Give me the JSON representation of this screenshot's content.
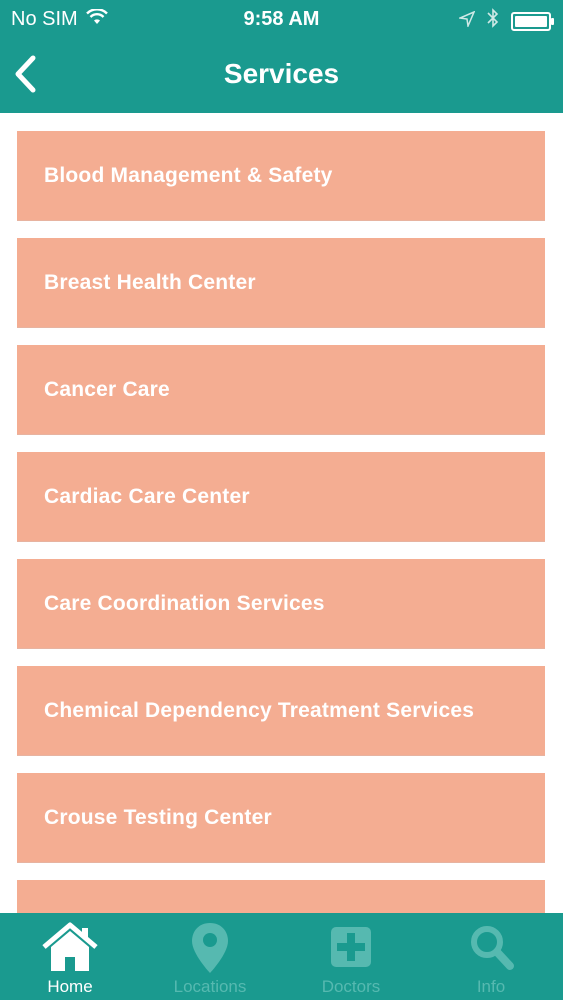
{
  "status_bar": {
    "carrier": "No SIM",
    "time": "9:58 AM"
  },
  "nav": {
    "title": "Services"
  },
  "services": [
    "Blood Management & Safety",
    "Breast Health Center",
    "Cancer Care",
    "Cardiac Care Center",
    "Care Coordination Services",
    "Chemical Dependency Treatment Services",
    "Crouse Testing Center",
    ""
  ],
  "tabs": [
    {
      "label": "Home",
      "icon": "home-icon",
      "active": true
    },
    {
      "label": "Locations",
      "icon": "location-pin-icon",
      "active": false
    },
    {
      "label": "Doctors",
      "icon": "medical-plus-icon",
      "active": false
    },
    {
      "label": "Info",
      "icon": "search-icon",
      "active": false
    }
  ],
  "colors": {
    "brand_teal": "#1a9a8f",
    "item_salmon": "#f4ad92",
    "inactive_tab": "#56b9b0"
  }
}
